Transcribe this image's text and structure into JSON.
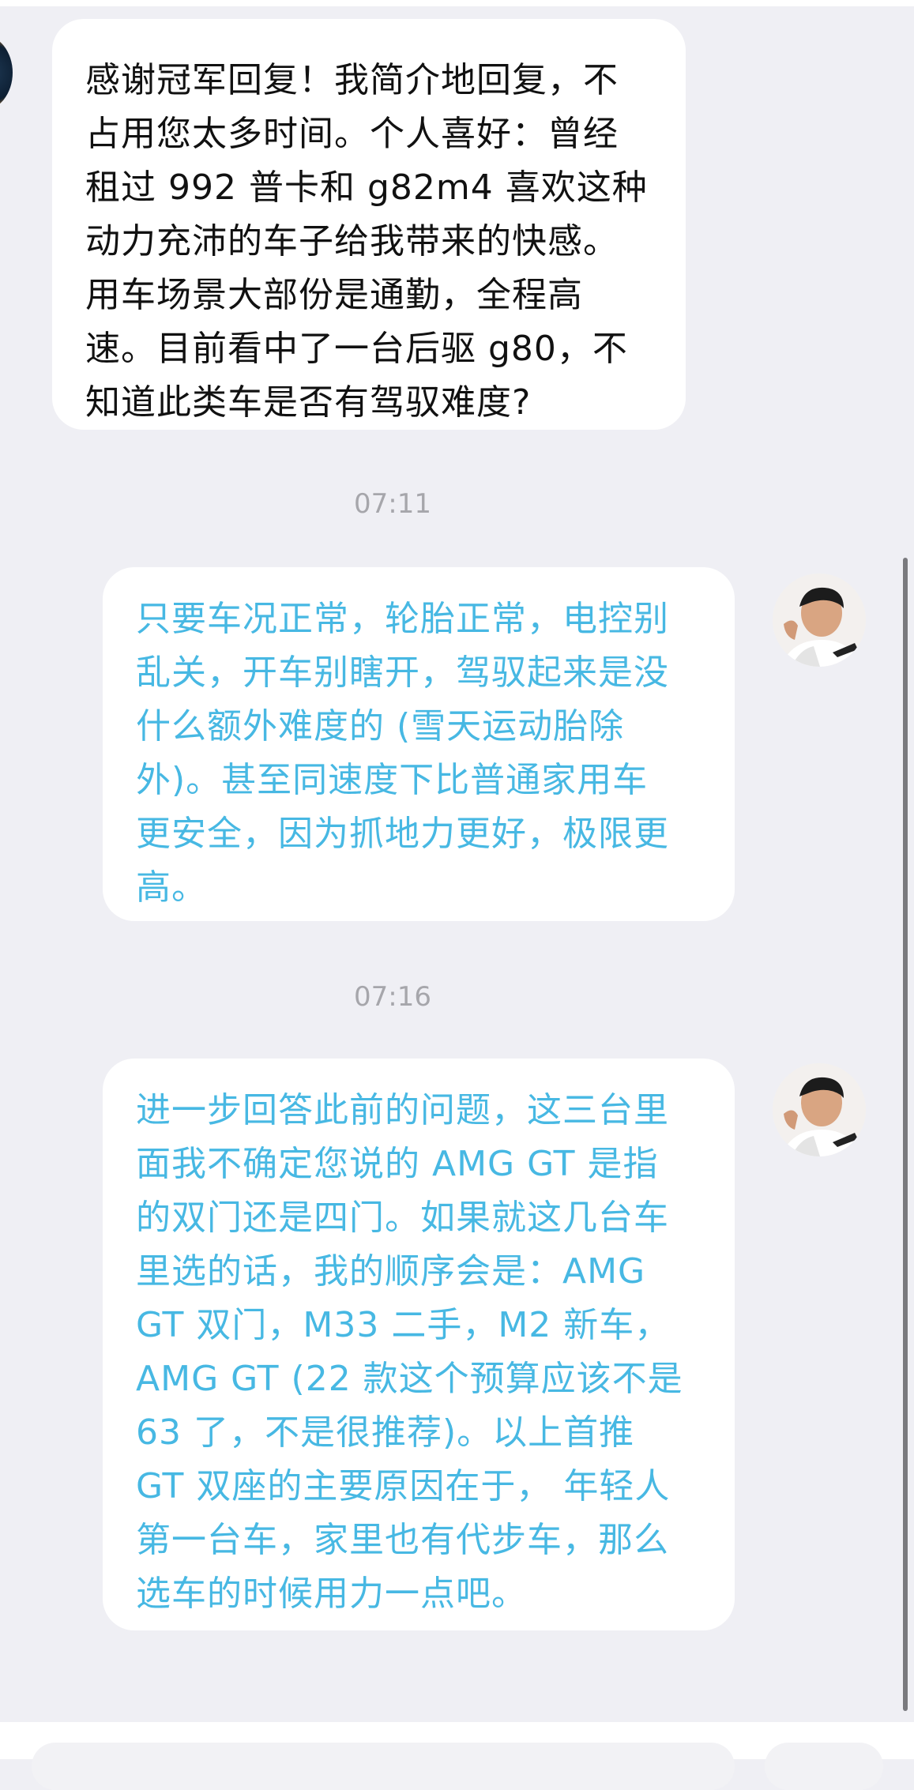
{
  "messages": [
    {
      "sender": "self",
      "text": "感谢冠军回复！我简介地回复，不\n占用您太多时间。个人喜好：曾经\n租过 992 普卡和 g82m4 喜欢这种\n动力充沛的车子给我带来的快感。\n用车场景大部份是通勤，全程高\n速。目前看中了一台后驱 g80，不\n知道此类车是否有驾驭难度?"
    },
    {
      "sender": "other",
      "timestamp": "07:11",
      "text": "只要车况正常，轮胎正常，电控别\n乱关，开车别瞎开，驾驭起来是没\n什么额外难度的 (雪天运动胎除\n外)。甚至同速度下比普通家用车\n更安全，因为抓地力更好，极限更\n高。"
    },
    {
      "sender": "other",
      "timestamp": "07:16",
      "text": "进一步回答此前的问题，这三台里\n面我不确定您说的 AMG GT 是指\n的双门还是四门。如果就这几台车\n里选的话，我的顺序会是：AMG\nGT 双门，M33 二手，M2 新车，\nAMG GT (22 款这个预算应该不是\n 63 了，不是很推荐)。以上首推\n GT 双座的主要原因在于， 年轻人\n第一台车，家里也有代步车，那么\n选车的时候用力一点吧。"
    }
  ],
  "colors": {
    "background": "#efeff4",
    "bubble": "#ffffff",
    "self_text": "#111111",
    "reply_text": "#47b8e3",
    "timestamp": "#a6a6ab"
  }
}
